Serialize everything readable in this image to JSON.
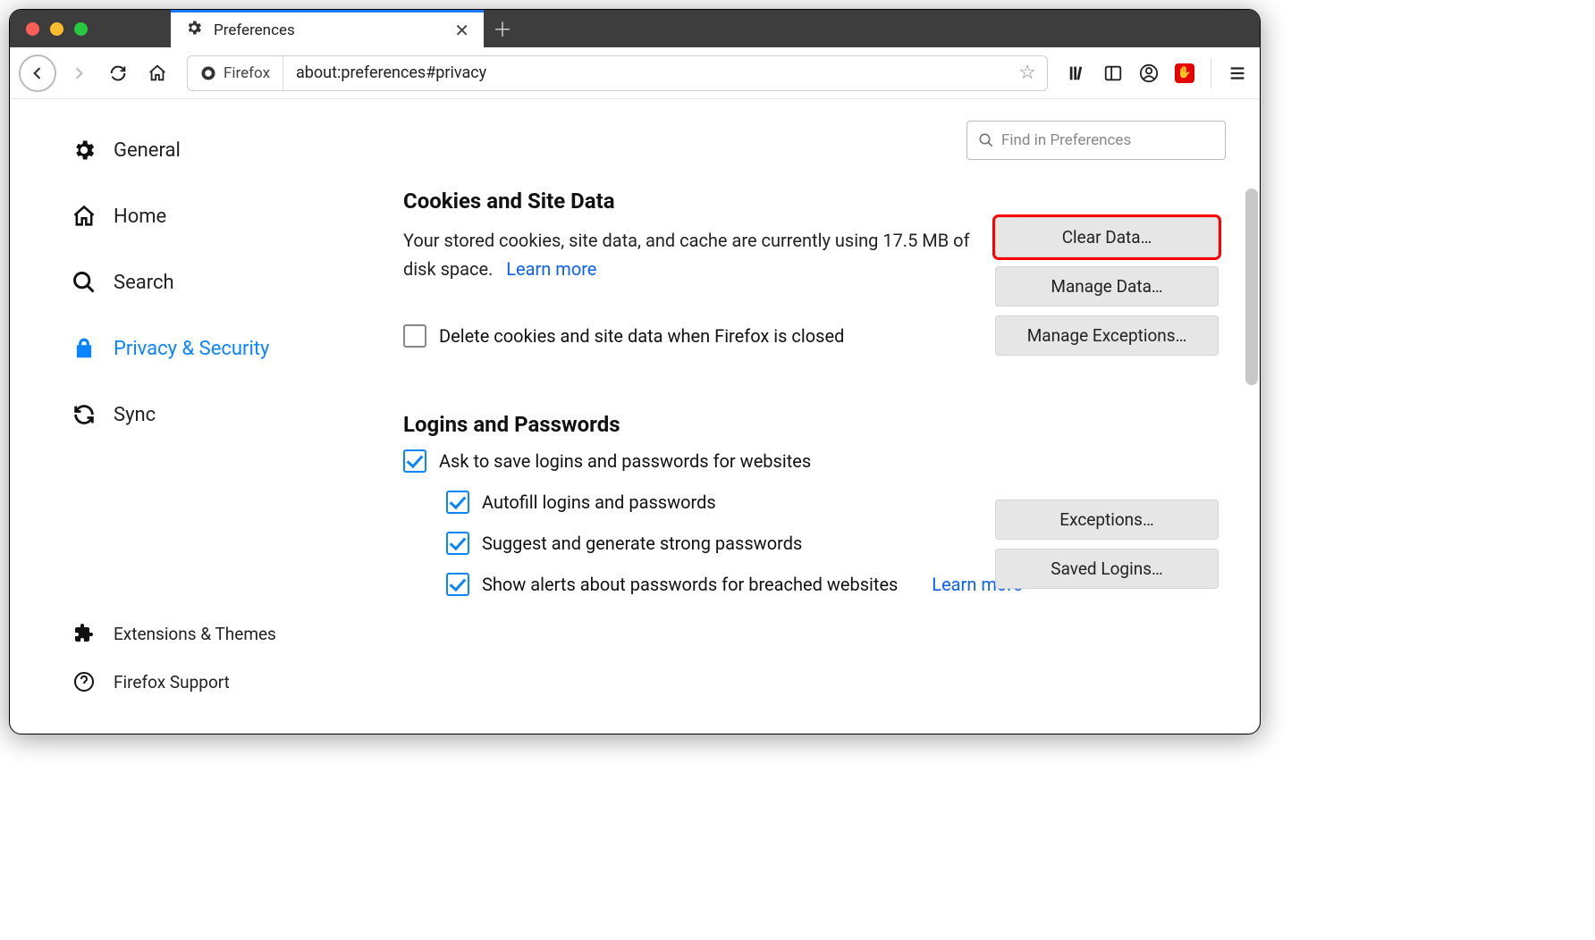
{
  "tab": {
    "title": "Preferences"
  },
  "url": {
    "identity": "Firefox",
    "address": "about:preferences#privacy"
  },
  "search": {
    "placeholder": "Find in Preferences"
  },
  "sidebar": {
    "items": [
      {
        "label": "General"
      },
      {
        "label": "Home"
      },
      {
        "label": "Search"
      },
      {
        "label": "Privacy & Security"
      },
      {
        "label": "Sync"
      }
    ],
    "bottom": [
      {
        "label": "Extensions & Themes"
      },
      {
        "label": "Firefox Support"
      }
    ]
  },
  "cookies": {
    "heading": "Cookies and Site Data",
    "desc_prefix": "Your stored cookies, site data, and cache are currently using ",
    "disk_usage": "17.5 MB",
    "desc_suffix": " of disk space.",
    "learn_more": "Learn more",
    "delete_on_close": "Delete cookies and site data when Firefox is closed",
    "buttons": {
      "clear": "Clear Data…",
      "manage": "Manage Data…",
      "exceptions": "Manage Exceptions…"
    }
  },
  "logins": {
    "heading": "Logins and Passwords",
    "ask_save": "Ask to save logins and passwords for websites",
    "autofill": "Autofill logins and passwords",
    "suggest": "Suggest and generate strong passwords",
    "alerts": "Show alerts about passwords for breached websites",
    "learn_more": "Learn more",
    "buttons": {
      "exceptions": "Exceptions…",
      "saved": "Saved Logins…"
    }
  }
}
